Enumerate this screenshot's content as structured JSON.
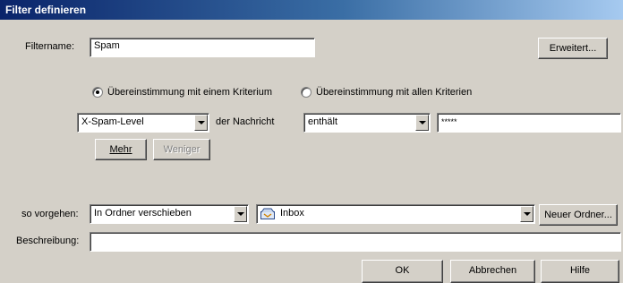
{
  "window": {
    "title": "Filter definieren"
  },
  "filtername": {
    "label": "Filtername:",
    "value": "Spam"
  },
  "buttons": {
    "advanced": "Erweitert...",
    "more": "Mehr",
    "fewer": "Weniger",
    "new_folder": "Neuer Ordner...",
    "ok": "OK",
    "cancel": "Abbrechen",
    "help": "Hilfe"
  },
  "match": {
    "any": "Übereinstimmung mit einem Kriterium",
    "all": "Übereinstimmung mit allen Kriterien",
    "selected": "any"
  },
  "criterion": {
    "field": "X-Spam-Level",
    "of_message": "der Nachricht",
    "operator": "enthält",
    "value": "*****"
  },
  "action": {
    "label": "so vorgehen:",
    "type": "In Ordner verschieben",
    "folder": "Inbox"
  },
  "description": {
    "label": "Beschreibung:",
    "value": ""
  },
  "icons": {
    "folder": "inbox-folder-icon",
    "dropdown": "dropdown-arrow-icon"
  }
}
